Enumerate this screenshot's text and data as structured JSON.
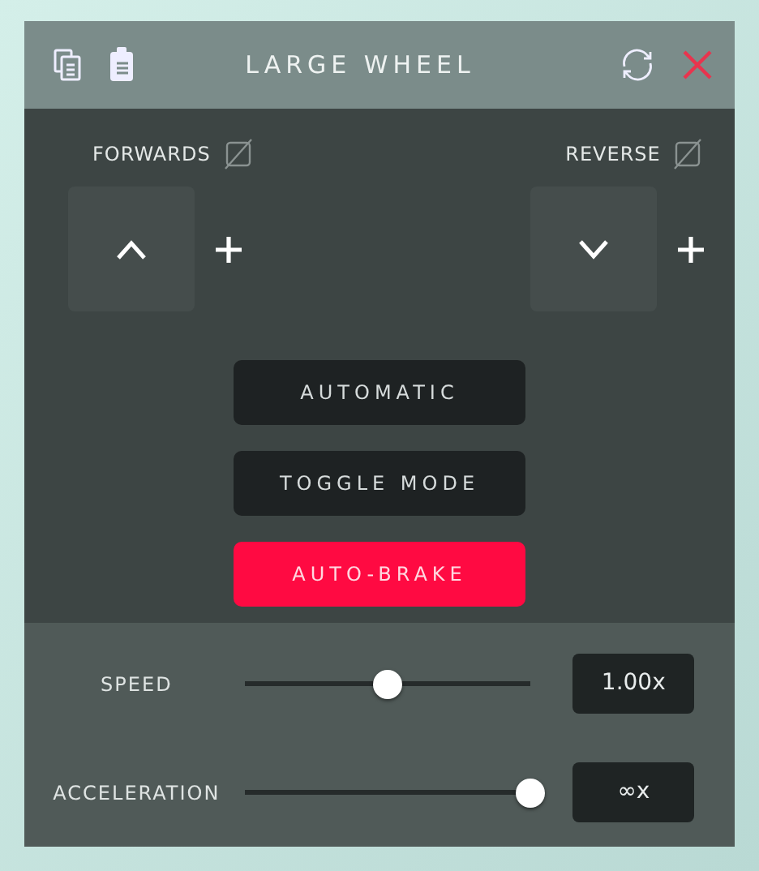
{
  "window": {
    "title": "LARGE WHEEL"
  },
  "bindings": [
    {
      "label": "FORWARDS",
      "kind": "up"
    },
    {
      "label": "REVERSE",
      "kind": "down"
    }
  ],
  "buttons": [
    {
      "label": "AUTOMATIC",
      "on": false
    },
    {
      "label": "TOGGLE MODE",
      "on": false
    },
    {
      "label": "AUTO-BRAKE",
      "on": true
    }
  ],
  "sliders": [
    {
      "label": "SPEED",
      "level": 0.5,
      "reading": "1.00x"
    },
    {
      "label": "ACCELERATION",
      "level": 1,
      "reading": "∞x"
    }
  ]
}
